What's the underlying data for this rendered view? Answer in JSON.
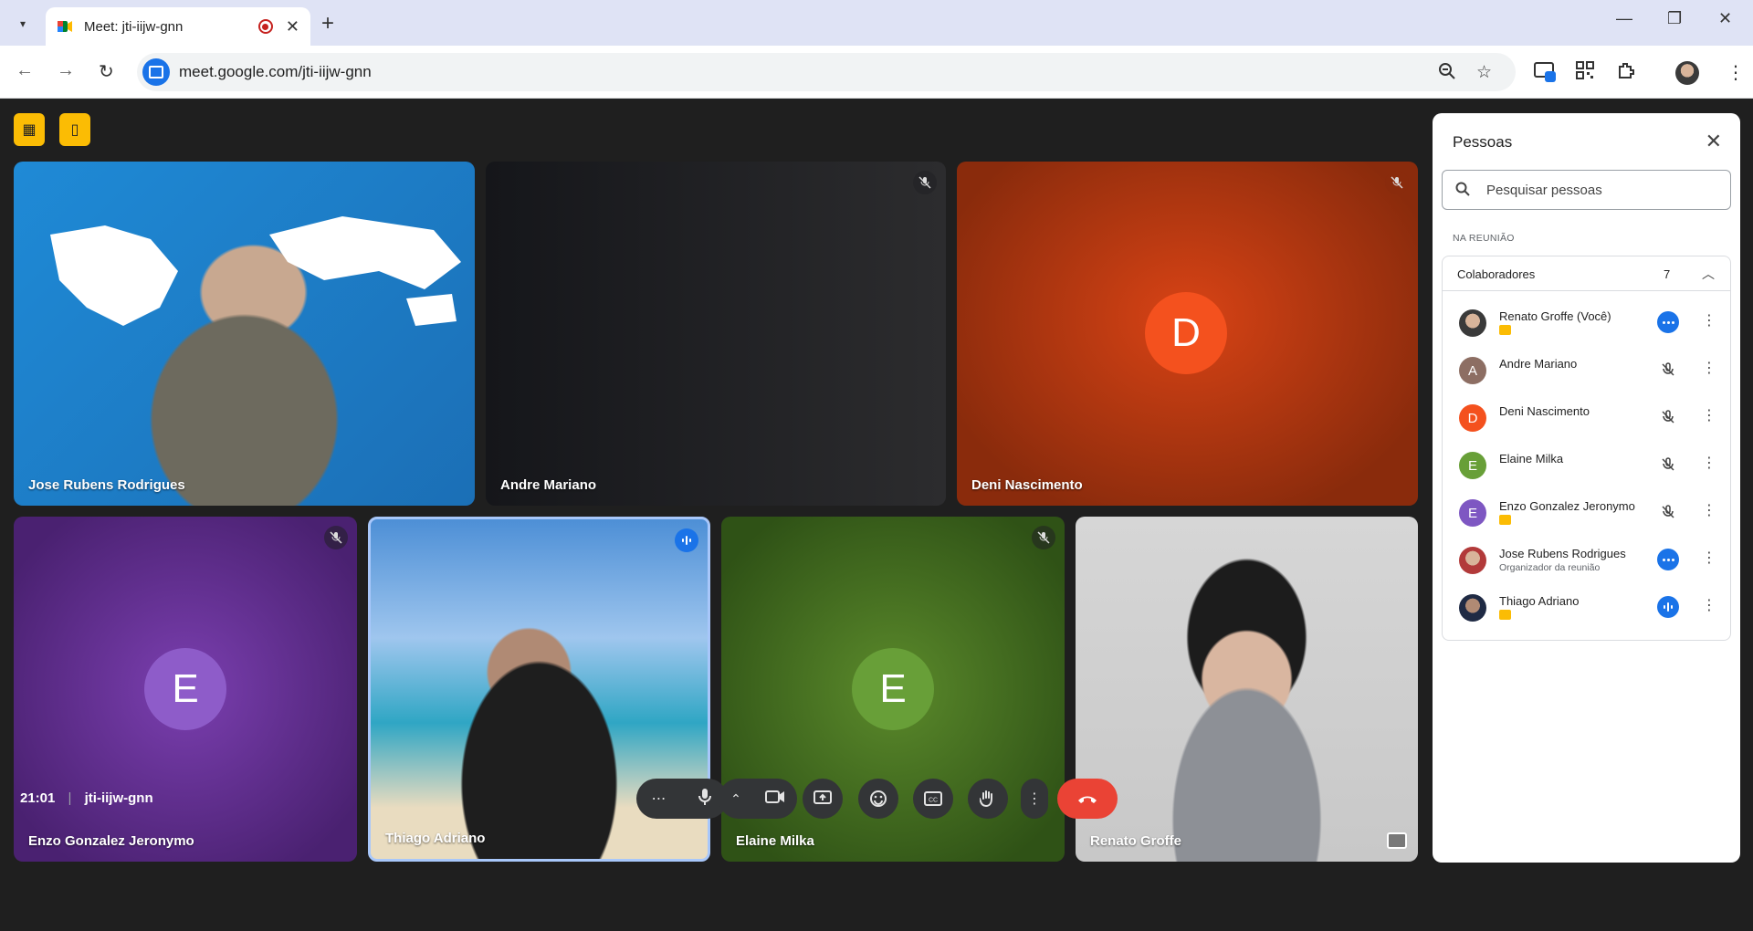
{
  "browser": {
    "tab_title": "Meet: jti-iijw-gnn",
    "url": "meet.google.com/jti-iijw-gnn"
  },
  "tiles": [
    {
      "name": "Jose Rubens Rodrigues",
      "type": "video"
    },
    {
      "name": "Andre Mariano",
      "type": "blank"
    },
    {
      "name": "Deni Nascimento",
      "type": "avatar",
      "initial": "D",
      "color": "#f4511e"
    },
    {
      "name": "Enzo Gonzalez Jeronymo",
      "type": "avatar",
      "initial": "E",
      "color": "#7e57c2"
    },
    {
      "name": "Thiago Adriano",
      "type": "video"
    },
    {
      "name": "Elaine Milka",
      "type": "avatar",
      "initial": "E",
      "color": "#689f38"
    },
    {
      "name": "Renato Groffe",
      "type": "video"
    }
  ],
  "footer": {
    "time": "21:01",
    "meeting_code": "jti-iijw-gnn",
    "people_count": "7"
  },
  "panel": {
    "title": "Pessoas",
    "search_placeholder": "Pesquisar pessoas",
    "section_label": "NA REUNIÃO",
    "group_name": "Colaboradores",
    "group_count": "7",
    "people": [
      {
        "name": "Renato Groffe (Você)",
        "sub": "",
        "badge": true,
        "state": "speaking-dots",
        "avatar": "photo"
      },
      {
        "name": "Andre Mariano",
        "sub": "",
        "badge": false,
        "state": "muted",
        "avatar": "A",
        "color": "#8d6e63"
      },
      {
        "name": "Deni Nascimento",
        "sub": "",
        "badge": false,
        "state": "muted",
        "avatar": "D",
        "color": "#f4511e"
      },
      {
        "name": "Elaine Milka",
        "sub": "",
        "badge": false,
        "state": "muted",
        "avatar": "E",
        "color": "#689f38"
      },
      {
        "name": "Enzo Gonzalez Jeronymo",
        "sub": "",
        "badge": true,
        "state": "muted",
        "avatar": "E",
        "color": "#7e57c2"
      },
      {
        "name": "Jose Rubens Rodrigues",
        "sub": "Organizador da reunião",
        "badge": false,
        "state": "speaking-dots",
        "avatar": "photo"
      },
      {
        "name": "Thiago Adriano",
        "sub": "",
        "badge": true,
        "state": "speaking-bars",
        "avatar": "photo"
      }
    ]
  }
}
